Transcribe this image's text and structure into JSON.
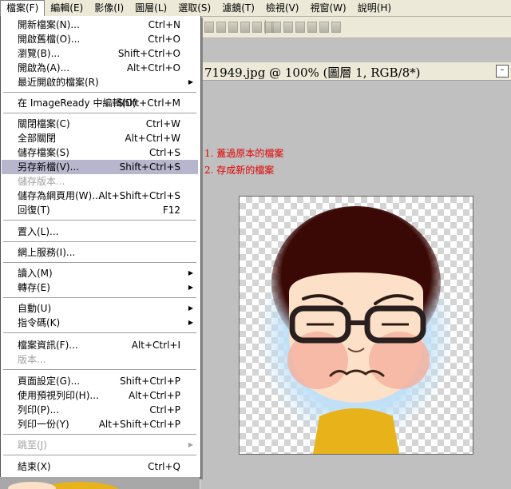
{
  "menubar": {
    "items": [
      "檔案(F)",
      "編輯(E)",
      "影像(I)",
      "圖層(L)",
      "選取(S)",
      "濾鏡(T)",
      "檢視(V)",
      "視窗(W)",
      "說明(H)"
    ]
  },
  "document": {
    "title": "71949.jpg @ 100% (圖層 1, RGB/8*)"
  },
  "annotations": {
    "line1": "1. 蓋過原本的檔案",
    "line2": "2. 存成新的檔案"
  },
  "file_menu": {
    "items": [
      {
        "label": "開新檔案(N)...",
        "shortcut": "Ctrl+N"
      },
      {
        "label": "開啟舊檔(O)...",
        "shortcut": "Ctrl+O"
      },
      {
        "label": "瀏覽(B)...",
        "shortcut": "Shift+Ctrl+O"
      },
      {
        "label": "開啟為(A)...",
        "shortcut": "Alt+Ctrl+O"
      },
      {
        "label": "最近開啟的檔案(R)",
        "shortcut": ""
      },
      {
        "label": "在 ImageReady 中編輯(D)",
        "shortcut": "Shift+Ctrl+M"
      },
      {
        "label": "關閉檔案(C)",
        "shortcut": "Ctrl+W"
      },
      {
        "label": "全部關閉",
        "shortcut": "Alt+Ctrl+W"
      },
      {
        "label": "儲存檔案(S)",
        "shortcut": "Ctrl+S"
      },
      {
        "label": "另存新檔(V)...",
        "shortcut": "Shift+Ctrl+S"
      },
      {
        "label": "儲存版本...",
        "shortcut": ""
      },
      {
        "label": "儲存為網頁用(W)...",
        "shortcut": "Alt+Shift+Ctrl+S"
      },
      {
        "label": "回復(T)",
        "shortcut": "F12"
      },
      {
        "label": "置入(L)...",
        "shortcut": ""
      },
      {
        "label": "網上服務(I)...",
        "shortcut": ""
      },
      {
        "label": "讀入(M)",
        "shortcut": ""
      },
      {
        "label": "轉存(E)",
        "shortcut": ""
      },
      {
        "label": "自動(U)",
        "shortcut": ""
      },
      {
        "label": "指令碼(K)",
        "shortcut": ""
      },
      {
        "label": "檔案資訊(F)...",
        "shortcut": "Alt+Ctrl+I"
      },
      {
        "label": "版本...",
        "shortcut": ""
      },
      {
        "label": "頁面設定(G)...",
        "shortcut": "Shift+Ctrl+P"
      },
      {
        "label": "使用預視列印(H)...",
        "shortcut": "Alt+Ctrl+P"
      },
      {
        "label": "列印(P)...",
        "shortcut": "Ctrl+P"
      },
      {
        "label": "列印一份(Y)",
        "shortcut": "Alt+Shift+Ctrl+P"
      },
      {
        "label": "跳至(J)",
        "shortcut": ""
      },
      {
        "label": "結束(X)",
        "shortcut": "Ctrl+Q"
      }
    ]
  },
  "colors": {
    "highlight": "#b8b6cc",
    "annotation": "#e00000",
    "disabled": "#a0a0a0"
  }
}
